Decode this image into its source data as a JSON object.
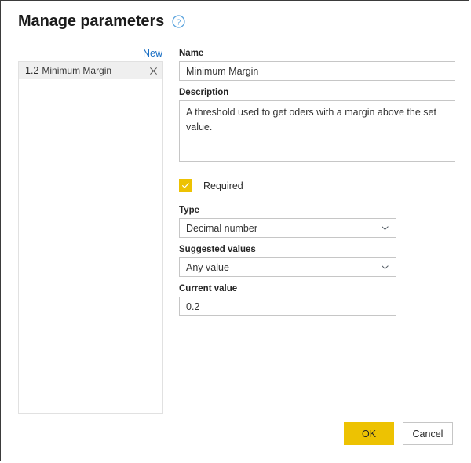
{
  "dialog": {
    "title": "Manage parameters",
    "help_icon": "help-circle-icon"
  },
  "list_panel": {
    "new_label": "New",
    "items": [
      {
        "number": "1.2",
        "label": "Minimum Margin",
        "remove_icon": "close-icon"
      }
    ]
  },
  "form": {
    "name": {
      "label": "Name",
      "value": "Minimum Margin",
      "placeholder": ""
    },
    "description": {
      "label": "Description",
      "value": "A threshold used to get oders with a margin above the set value.",
      "placeholder": ""
    },
    "required": {
      "label": "Required",
      "checked": true
    },
    "type": {
      "label": "Type",
      "value": "Decimal number",
      "chevron_icon": "chevron-down-icon"
    },
    "suggested_values": {
      "label": "Suggested values",
      "value": "Any value",
      "chevron_icon": "chevron-down-icon"
    },
    "current_value": {
      "label": "Current value",
      "value": "0.2",
      "placeholder": ""
    }
  },
  "footer": {
    "ok_label": "OK",
    "cancel_label": "Cancel"
  },
  "colors": {
    "accent_yellow": "#edc202",
    "link_blue": "#1a6fc4",
    "border_gray": "#c6c6c6",
    "row_selected": "#efefef"
  }
}
